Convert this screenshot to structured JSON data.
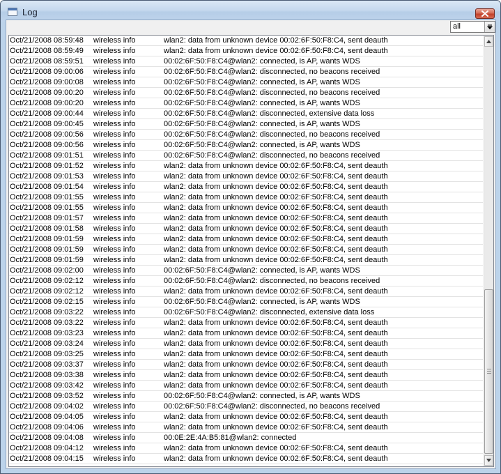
{
  "window": {
    "title": "Log",
    "close_icon": "close-icon"
  },
  "filter": {
    "selected": "all"
  },
  "log": {
    "entries": [
      {
        "time": "Oct/21/2008 08:59:48",
        "topics": "wireless info",
        "message": "wlan2: data from unknown device 00:02:6F:50:F8:C4, sent deauth"
      },
      {
        "time": "Oct/21/2008 08:59:49",
        "topics": "wireless info",
        "message": "wlan2: data from unknown device 00:02:6F:50:F8:C4, sent deauth"
      },
      {
        "time": "Oct/21/2008 08:59:51",
        "topics": "wireless info",
        "message": "00:02:6F:50:F8:C4@wlan2: connected, is AP, wants WDS"
      },
      {
        "time": "Oct/21/2008 09:00:06",
        "topics": "wireless info",
        "message": "00:02:6F:50:F8:C4@wlan2: disconnected, no beacons received"
      },
      {
        "time": "Oct/21/2008 09:00:08",
        "topics": "wireless info",
        "message": "00:02:6F:50:F8:C4@wlan2: connected, is AP, wants WDS"
      },
      {
        "time": "Oct/21/2008 09:00:20",
        "topics": "wireless info",
        "message": "00:02:6F:50:F8:C4@wlan2: disconnected, no beacons received"
      },
      {
        "time": "Oct/21/2008 09:00:20",
        "topics": "wireless info",
        "message": "00:02:6F:50:F8:C4@wlan2: connected, is AP, wants WDS"
      },
      {
        "time": "Oct/21/2008 09:00:44",
        "topics": "wireless info",
        "message": "00:02:6F:50:F8:C4@wlan2: disconnected, extensive data loss"
      },
      {
        "time": "Oct/21/2008 09:00:45",
        "topics": "wireless info",
        "message": "00:02:6F:50:F8:C4@wlan2: connected, is AP, wants WDS"
      },
      {
        "time": "Oct/21/2008 09:00:56",
        "topics": "wireless info",
        "message": "00:02:6F:50:F8:C4@wlan2: disconnected, no beacons received"
      },
      {
        "time": "Oct/21/2008 09:00:56",
        "topics": "wireless info",
        "message": "00:02:6F:50:F8:C4@wlan2: connected, is AP, wants WDS"
      },
      {
        "time": "Oct/21/2008 09:01:51",
        "topics": "wireless info",
        "message": "00:02:6F:50:F8:C4@wlan2: disconnected, no beacons received"
      },
      {
        "time": "Oct/21/2008 09:01:52",
        "topics": "wireless info",
        "message": "wlan2: data from unknown device 00:02:6F:50:F8:C4, sent deauth"
      },
      {
        "time": "Oct/21/2008 09:01:53",
        "topics": "wireless info",
        "message": "wlan2: data from unknown device 00:02:6F:50:F8:C4, sent deauth"
      },
      {
        "time": "Oct/21/2008 09:01:54",
        "topics": "wireless info",
        "message": "wlan2: data from unknown device 00:02:6F:50:F8:C4, sent deauth"
      },
      {
        "time": "Oct/21/2008 09:01:55",
        "topics": "wireless info",
        "message": "wlan2: data from unknown device 00:02:6F:50:F8:C4, sent deauth"
      },
      {
        "time": "Oct/21/2008 09:01:55",
        "topics": "wireless info",
        "message": "wlan2: data from unknown device 00:02:6F:50:F8:C4, sent deauth"
      },
      {
        "time": "Oct/21/2008 09:01:57",
        "topics": "wireless info",
        "message": "wlan2: data from unknown device 00:02:6F:50:F8:C4, sent deauth"
      },
      {
        "time": "Oct/21/2008 09:01:58",
        "topics": "wireless info",
        "message": "wlan2: data from unknown device 00:02:6F:50:F8:C4, sent deauth"
      },
      {
        "time": "Oct/21/2008 09:01:59",
        "topics": "wireless info",
        "message": "wlan2: data from unknown device 00:02:6F:50:F8:C4, sent deauth"
      },
      {
        "time": "Oct/21/2008 09:01:59",
        "topics": "wireless info",
        "message": "wlan2: data from unknown device 00:02:6F:50:F8:C4, sent deauth"
      },
      {
        "time": "Oct/21/2008 09:01:59",
        "topics": "wireless info",
        "message": "wlan2: data from unknown device 00:02:6F:50:F8:C4, sent deauth"
      },
      {
        "time": "Oct/21/2008 09:02:00",
        "topics": "wireless info",
        "message": "00:02:6F:50:F8:C4@wlan2: connected, is AP, wants WDS"
      },
      {
        "time": "Oct/21/2008 09:02:12",
        "topics": "wireless info",
        "message": "00:02:6F:50:F8:C4@wlan2: disconnected, no beacons received"
      },
      {
        "time": "Oct/21/2008 09:02:12",
        "topics": "wireless info",
        "message": "wlan2: data from unknown device 00:02:6F:50:F8:C4, sent deauth"
      },
      {
        "time": "Oct/21/2008 09:02:15",
        "topics": "wireless info",
        "message": "00:02:6F:50:F8:C4@wlan2: connected, is AP, wants WDS"
      },
      {
        "time": "Oct/21/2008 09:03:22",
        "topics": "wireless info",
        "message": "00:02:6F:50:F8:C4@wlan2: disconnected, extensive data loss"
      },
      {
        "time": "Oct/21/2008 09:03:22",
        "topics": "wireless info",
        "message": "wlan2: data from unknown device 00:02:6F:50:F8:C4, sent deauth"
      },
      {
        "time": "Oct/21/2008 09:03:23",
        "topics": "wireless info",
        "message": "wlan2: data from unknown device 00:02:6F:50:F8:C4, sent deauth"
      },
      {
        "time": "Oct/21/2008 09:03:24",
        "topics": "wireless info",
        "message": "wlan2: data from unknown device 00:02:6F:50:F8:C4, sent deauth"
      },
      {
        "time": "Oct/21/2008 09:03:25",
        "topics": "wireless info",
        "message": "wlan2: data from unknown device 00:02:6F:50:F8:C4, sent deauth"
      },
      {
        "time": "Oct/21/2008 09:03:37",
        "topics": "wireless info",
        "message": "wlan2: data from unknown device 00:02:6F:50:F8:C4, sent deauth"
      },
      {
        "time": "Oct/21/2008 09:03:38",
        "topics": "wireless info",
        "message": "wlan2: data from unknown device 00:02:6F:50:F8:C4, sent deauth"
      },
      {
        "time": "Oct/21/2008 09:03:42",
        "topics": "wireless info",
        "message": "wlan2: data from unknown device 00:02:6F:50:F8:C4, sent deauth"
      },
      {
        "time": "Oct/21/2008 09:03:52",
        "topics": "wireless info",
        "message": "00:02:6F:50:F8:C4@wlan2: connected, is AP, wants WDS"
      },
      {
        "time": "Oct/21/2008 09:04:02",
        "topics": "wireless info",
        "message": "00:02:6F:50:F8:C4@wlan2: disconnected, no beacons received"
      },
      {
        "time": "Oct/21/2008 09:04:05",
        "topics": "wireless info",
        "message": "wlan2: data from unknown device 00:02:6F:50:F8:C4, sent deauth"
      },
      {
        "time": "Oct/21/2008 09:04:06",
        "topics": "wireless info",
        "message": "wlan2: data from unknown device 00:02:6F:50:F8:C4, sent deauth"
      },
      {
        "time": "Oct/21/2008 09:04:08",
        "topics": "wireless info",
        "message": "00:0E:2E:4A:B5:81@wlan2: connected"
      },
      {
        "time": "Oct/21/2008 09:04:12",
        "topics": "wireless info",
        "message": "wlan2: data from unknown device 00:02:6F:50:F8:C4, sent deauth"
      },
      {
        "time": "Oct/21/2008 09:04:15",
        "topics": "wireless info",
        "message": "wlan2: data from unknown device 00:02:6F:50:F8:C4, sent deauth"
      }
    ]
  },
  "scrollbar": {
    "up_icon": "scroll-up-icon",
    "down_icon": "scroll-down-icon"
  }
}
